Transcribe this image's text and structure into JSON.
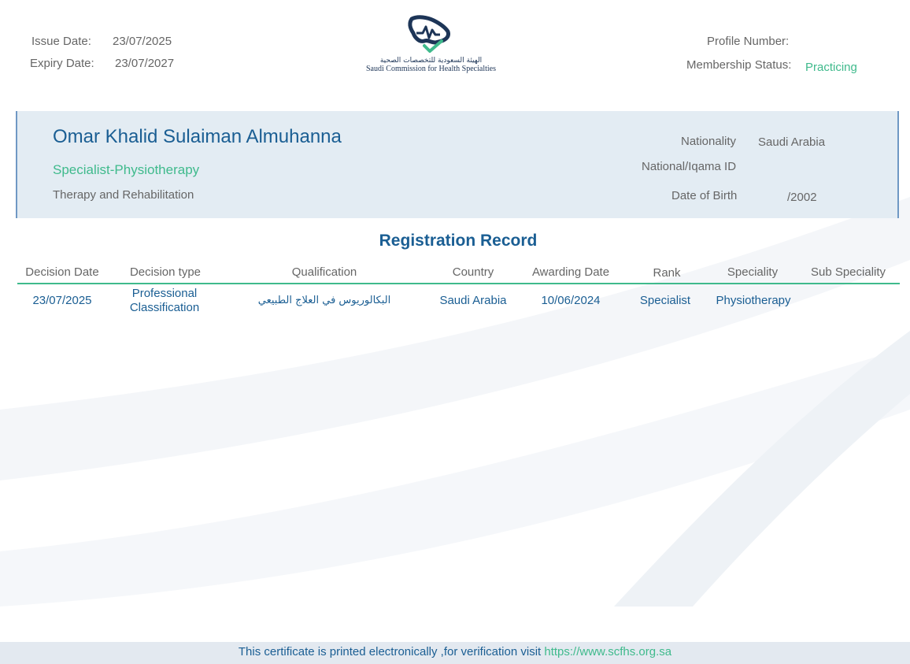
{
  "header": {
    "issue_date_label": "Issue Date:",
    "issue_date": "23/07/2025",
    "expiry_date_label": "Expiry Date:",
    "expiry_date": "23/07/2027",
    "profile_number_label": "Profile Number:",
    "profile_number": "",
    "membership_status_label": "Membership Status:",
    "membership_status": "Practicing"
  },
  "logo": {
    "arabic": "الهيئة السعودية للتخصصات الصحية",
    "english": "Saudi Commission for Health Specialties"
  },
  "profile": {
    "name": "Omar Khalid Sulaiman Almuhanna",
    "title": "Specialist-Physiotherapy",
    "department": "Therapy and Rehabilitation",
    "nationality_label": "Nationality",
    "nationality": "Saudi Arabia",
    "id_label": "National/Iqama ID",
    "id_value": "",
    "dob_label": "Date of Birth",
    "dob": "/2002"
  },
  "registration": {
    "title": "Registration Record",
    "columns": [
      "Decision Date",
      "Decision type",
      "Qualification",
      "Country",
      "Awarding Date",
      "Rank",
      "Speciality",
      "Sub Speciality"
    ],
    "rows": [
      {
        "decision_date": "23/07/2025",
        "decision_type_line1": "Professional",
        "decision_type_line2": "Classification",
        "qualification": "البكالوريوس في العلاج الطبيعي",
        "country": "Saudi Arabia",
        "awarding_date": "10/06/2024",
        "rank": "Specialist",
        "speciality": "Physiotherapy",
        "sub_speciality": ""
      }
    ]
  },
  "footer": {
    "text": "This certificate is printed electronically ,for verification visit",
    "link": "https://www.scfhs.org.sa"
  },
  "colors": {
    "accent_blue": "#1a5e93",
    "accent_green": "#3fba8c",
    "card_bg": "#e3ecf3"
  }
}
